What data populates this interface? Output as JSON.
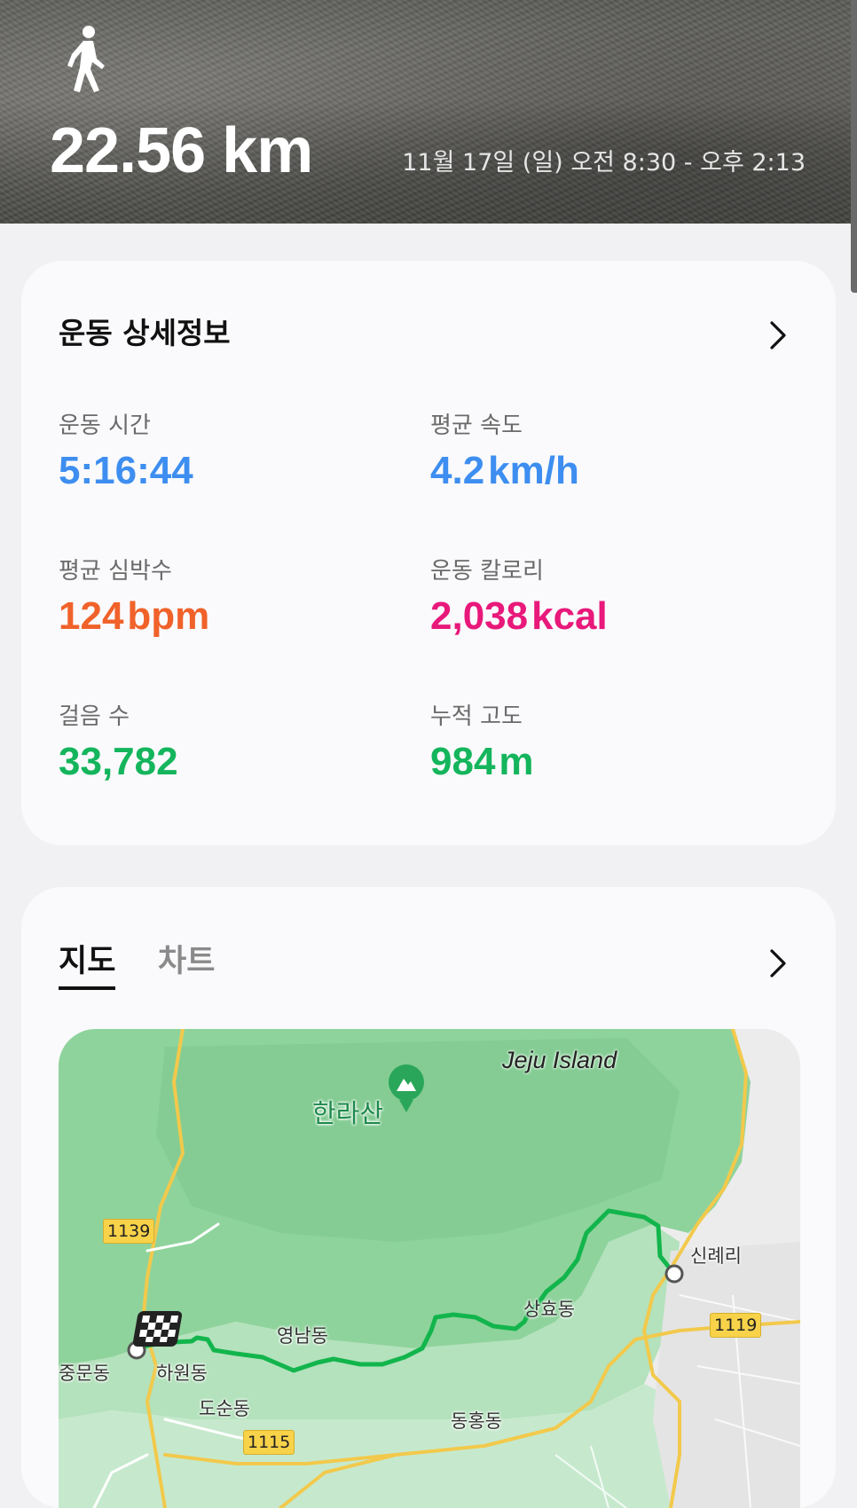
{
  "hero": {
    "activity_icon": "walking-person-icon",
    "distance": "22.56 km",
    "date_range": "11월 17일 (일) 오전 8:30 - 오후 2:13"
  },
  "details": {
    "title": "운동 상세정보",
    "stats": [
      {
        "label": "운동 시간",
        "value": "5:16:44",
        "unit": "",
        "color": "#3d8ef0"
      },
      {
        "label": "평균 속도",
        "value": "4.2",
        "unit": "km/h",
        "color": "#3d8ef0"
      },
      {
        "label": "평균 심박수",
        "value": "124",
        "unit": "bpm",
        "color": "#f0622a"
      },
      {
        "label": "운동 칼로리",
        "value": "2,038",
        "unit": "kcal",
        "color": "#e8197a"
      },
      {
        "label": "걸음 수",
        "value": "33,782",
        "unit": "",
        "color": "#14b55c"
      },
      {
        "label": "누적 고도",
        "value": "984",
        "unit": "m",
        "color": "#14b55c"
      }
    ]
  },
  "map_section": {
    "tabs": [
      {
        "label": "지도",
        "active": true
      },
      {
        "label": "차트",
        "active": false
      }
    ],
    "map": {
      "title": "Jeju Island",
      "peak": "한라산",
      "places": [
        "신례리",
        "상효동",
        "영남동",
        "중문동",
        "하원동",
        "도순동",
        "동홍동"
      ],
      "roads": [
        "1139",
        "1119",
        "1115"
      ],
      "route_color": "#12b54c"
    }
  }
}
